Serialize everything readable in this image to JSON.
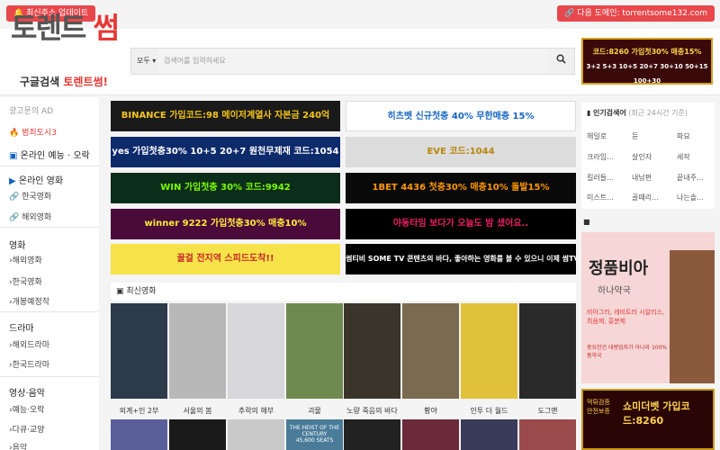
{
  "topbar": {
    "left_pill": "🔔 최신주소 업데이트",
    "right_pill": "🔗 다음 도메인: torrentsome132.com"
  },
  "header": {
    "logo_part1": "토렌트",
    "logo_part2": "썸",
    "tagline_part1": "구글검색",
    "tagline_part2": "토렌트썸!",
    "search_select": "모두 ▾",
    "search_placeholder": "검색어를 입력하세요",
    "search_icon": "search-icon",
    "top_banner_text1": "코드:8260 가입첫30% 매충15%",
    "top_banner_text2": "3+2 5+3 10+5 20+7 30+10 50+15 100+30"
  },
  "sidebar": {
    "ad_label": "광고문의 AD",
    "hot_label": "범죄도시3",
    "online_tv": "온라인 예능 · 오락",
    "online_movie": "온라인 영화",
    "online_korean": "한국영화",
    "online_foreign": "해외영화",
    "movie_head": "영화",
    "movie_foreign": "해외영화",
    "movie_korean": "한국영화",
    "movie_upcoming": "개봉예정작",
    "drama_head": "드라마",
    "drama_foreign": "해외드라마",
    "drama_korean": "한국드라마",
    "video_head": "영상·음악",
    "video_variety": "예능·오락",
    "video_docu": "다큐·교양",
    "video_music": "음악"
  },
  "banners": {
    "b1": "BINANCE 가입코드:98 메이저계열사 자본금 240억",
    "b2": "히츠벳 신규첫충 40% 무한매충 15%",
    "b3": "yes 가입첫충30% 10+5 20+7 원천무제재 코드:1054",
    "b4": "EVE 코드:1044",
    "b5": "WIN 가입첫충 30% 코드:9942",
    "b6": "1BET 4436 첫충30% 매충10% 돌발15%",
    "b7": "winner 9222 가입첫충30% 매충10%",
    "b8": "야동타임 보다가 오늘도 밤 샜어요..",
    "b9": "꿀걸 전지역 스피드도착!!",
    "b10": "썸티비 SOME TV 콘텐츠의 바다, 좋아하는 영화를 볼 수 있으니 이제 썸TV하러 가자!"
  },
  "section": {
    "title": "최신영화"
  },
  "posters": [
    {
      "title": "외계+인 2부",
      "color": "#2c3a4a"
    },
    {
      "title": "서울의 봄",
      "color": "#b8b8b8"
    },
    {
      "title": "추락의 해부",
      "color": "#d8d8dc"
    },
    {
      "title": "괴물",
      "color": "#6f8a4e"
    },
    {
      "title": "노량 죽음의 바다",
      "color": "#3a342a"
    },
    {
      "title": "황야",
      "color": "#7a6a4f"
    },
    {
      "title": "인투 더 월드",
      "color": "#e2c13a"
    },
    {
      "title": "도그맨",
      "color": "#2a2a2a"
    }
  ],
  "posters_row2_colors": [
    "#5a5f9a",
    "#1a1a1a",
    "#c9c9c9",
    "#4a7c9a",
    "#222222",
    "#6a2a3a",
    "#3a3a5a",
    "#9a4a4a"
  ],
  "posters_row2_text": {
    "p3": "THE HEIST OF THE CENTURY",
    "p3b": "45,600 SEATS"
  },
  "right": {
    "popular_head": "인기검색어",
    "popular_sub": "(최근 24시간 기준)",
    "keywords": [
      "헤일로",
      "듄",
      "파묘",
      "크라임...",
      "살인자",
      "세작",
      "킬러들...",
      "내남편",
      "끝내주...",
      "미스트...",
      "골때리...",
      "나는솔..."
    ],
    "ad_title": "정품비아",
    "ad_sub": "하나약국",
    "ad_desc": "비아그라, 레비트라 시알리스, 최음제, 흥분제",
    "ad_desc2": "중요한건 대량업자가 아니라 100% 정품약국",
    "ad2_text": "쇼미더벳 가입코드:8260",
    "ad2_side": "먹튀검증 안전보증"
  }
}
